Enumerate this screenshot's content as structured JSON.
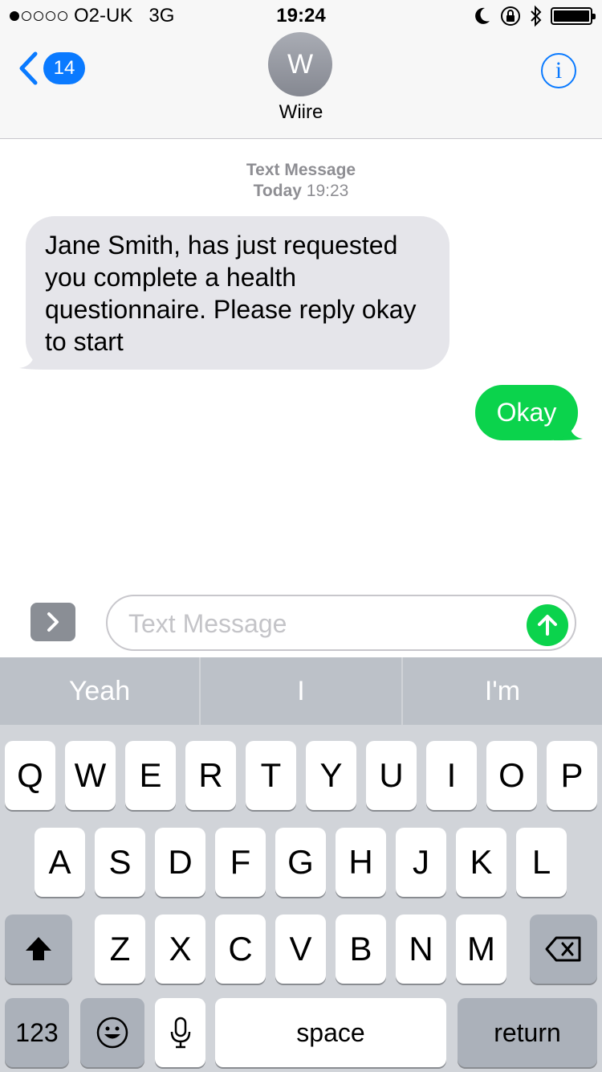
{
  "status_bar": {
    "carrier": "O2-UK",
    "network": "3G",
    "time": "19:24"
  },
  "nav": {
    "back_badge": "14",
    "avatar_initial": "W",
    "contact_name": "Wiire",
    "info_icon": "i"
  },
  "conversation": {
    "service_label": "Text Message",
    "date_label": "Today",
    "date_time": "19:23",
    "messages": [
      {
        "direction": "incoming",
        "text": "Jane Smith, has just requested you complete a health questionnaire. Please reply okay to start"
      },
      {
        "direction": "outgoing",
        "text": "Okay"
      }
    ]
  },
  "composer": {
    "placeholder": "Text Message",
    "value": ""
  },
  "keyboard": {
    "predictions": [
      "Yeah",
      "I",
      "I'm"
    ],
    "row1": [
      "Q",
      "W",
      "E",
      "R",
      "T",
      "Y",
      "U",
      "I",
      "O",
      "P"
    ],
    "row2": [
      "A",
      "S",
      "D",
      "F",
      "G",
      "H",
      "J",
      "K",
      "L"
    ],
    "row3": [
      "Z",
      "X",
      "C",
      "V",
      "B",
      "N",
      "M"
    ],
    "numbers_label": "123",
    "space_label": "space",
    "return_label": "return"
  },
  "colors": {
    "ios_blue": "#0a7aff",
    "imessage_green": "#0bd34c",
    "incoming_bubble": "#e5e5ea",
    "keyboard_bg": "#d1d4d9"
  },
  "icons": {
    "back": "chevron-left-icon",
    "info": "info-icon",
    "apps": "chevron-right-icon",
    "send": "arrow-up-icon",
    "shift": "shift-arrow-icon",
    "delete": "backspace-icon",
    "emoji": "smiley-icon",
    "dictation": "microphone-icon",
    "moon": "do-not-disturb-moon-icon",
    "rotation_lock": "rotation-lock-icon",
    "bluetooth": "bluetooth-icon",
    "battery": "battery-icon"
  }
}
